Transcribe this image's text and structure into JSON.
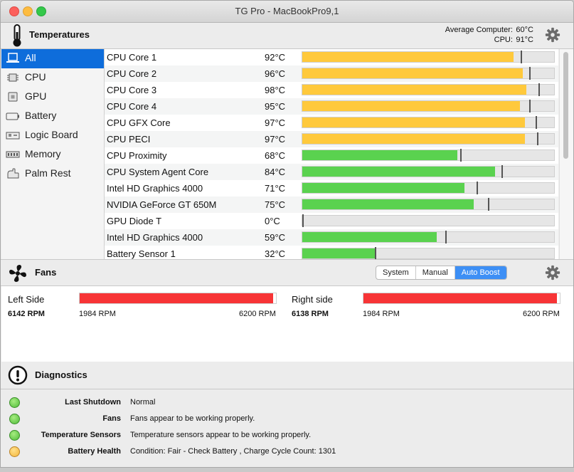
{
  "window": {
    "title": "TG Pro - MacBookPro9,1"
  },
  "temperatures": {
    "title": "Temperatures",
    "average_label": "Average Computer:",
    "average_value": "60°C",
    "cpu_label": "CPU:",
    "cpu_value": "91°C"
  },
  "sidebar": {
    "items": [
      {
        "label": "All",
        "icon": "laptop-icon",
        "selected": true
      },
      {
        "label": "CPU",
        "icon": "cpu-chip-icon",
        "selected": false
      },
      {
        "label": "GPU",
        "icon": "gpu-chip-icon",
        "selected": false
      },
      {
        "label": "Battery",
        "icon": "battery-icon",
        "selected": false
      },
      {
        "label": "Logic Board",
        "icon": "logic-board-icon",
        "selected": false
      },
      {
        "label": "Memory",
        "icon": "memory-icon",
        "selected": false
      },
      {
        "label": "Palm Rest",
        "icon": "palm-rest-icon",
        "selected": false
      }
    ]
  },
  "sensors": [
    {
      "name": "CPU Core 1",
      "temp": "92°C",
      "level": 0.84,
      "marker": 0.87,
      "status": "warm"
    },
    {
      "name": "CPU Core 2",
      "temp": "96°C",
      "level": 0.875,
      "marker": 0.905,
      "status": "warm"
    },
    {
      "name": "CPU Core 3",
      "temp": "98°C",
      "level": 0.89,
      "marker": 0.94,
      "status": "warm"
    },
    {
      "name": "CPU Core 4",
      "temp": "95°C",
      "level": 0.865,
      "marker": 0.905,
      "status": "warm"
    },
    {
      "name": "CPU GFX Core",
      "temp": "97°C",
      "level": 0.885,
      "marker": 0.93,
      "status": "warm"
    },
    {
      "name": "CPU PECI",
      "temp": "97°C",
      "level": 0.885,
      "marker": 0.935,
      "status": "warm"
    },
    {
      "name": "CPU Proximity",
      "temp": "68°C",
      "level": 0.615,
      "marker": 0.63,
      "status": "ok"
    },
    {
      "name": "CPU System Agent Core",
      "temp": "84°C",
      "level": 0.765,
      "marker": 0.795,
      "status": "ok"
    },
    {
      "name": "Intel HD Graphics 4000",
      "temp": "71°C",
      "level": 0.645,
      "marker": 0.695,
      "status": "ok"
    },
    {
      "name": "NVIDIA GeForce GT 650M",
      "temp": "75°C",
      "level": 0.68,
      "marker": 0.74,
      "status": "ok"
    },
    {
      "name": "GPU Diode T",
      "temp": "0°C",
      "level": 0.0,
      "marker": 0.003,
      "status": "ok"
    },
    {
      "name": "Intel HD Graphics 4000",
      "temp": "59°C",
      "level": 0.535,
      "marker": 0.57,
      "status": "ok"
    },
    {
      "name": "Battery Sensor 1",
      "temp": "32°C",
      "level": 0.29,
      "marker": 0.29,
      "status": "ok"
    }
  ],
  "fans": {
    "title": "Fans",
    "modes": [
      {
        "label": "System",
        "active": false
      },
      {
        "label": "Manual",
        "active": false
      },
      {
        "label": "Auto Boost",
        "active": true
      }
    ],
    "left": {
      "label": "Left Side",
      "rpm": "6142 RPM",
      "min": "1984 RPM",
      "max": "6200 RPM",
      "level": 0.986
    },
    "right": {
      "label": "Right side",
      "rpm": "6138 RPM",
      "min": "1984 RPM",
      "max": "6200 RPM",
      "level": 0.985
    }
  },
  "diagnostics": {
    "title": "Diagnostics",
    "items": [
      {
        "label": "Last Shutdown",
        "value": "Normal",
        "status": "green"
      },
      {
        "label": "Fans",
        "value": "Fans appear to be working properly.",
        "status": "green"
      },
      {
        "label": "Temperature Sensors",
        "value": "Temperature sensors appear to be working properly.",
        "status": "green"
      },
      {
        "label": "Battery Health",
        "value": "Condition: Fair - Check Battery , Charge Cycle Count: 1301",
        "status": "amber"
      }
    ]
  },
  "colors": {
    "warm": "#ffc93c",
    "ok": "#5ad24f",
    "fan": "#f73436",
    "selection": "#0e6ddb",
    "active_mode": "#3d8ff5"
  }
}
